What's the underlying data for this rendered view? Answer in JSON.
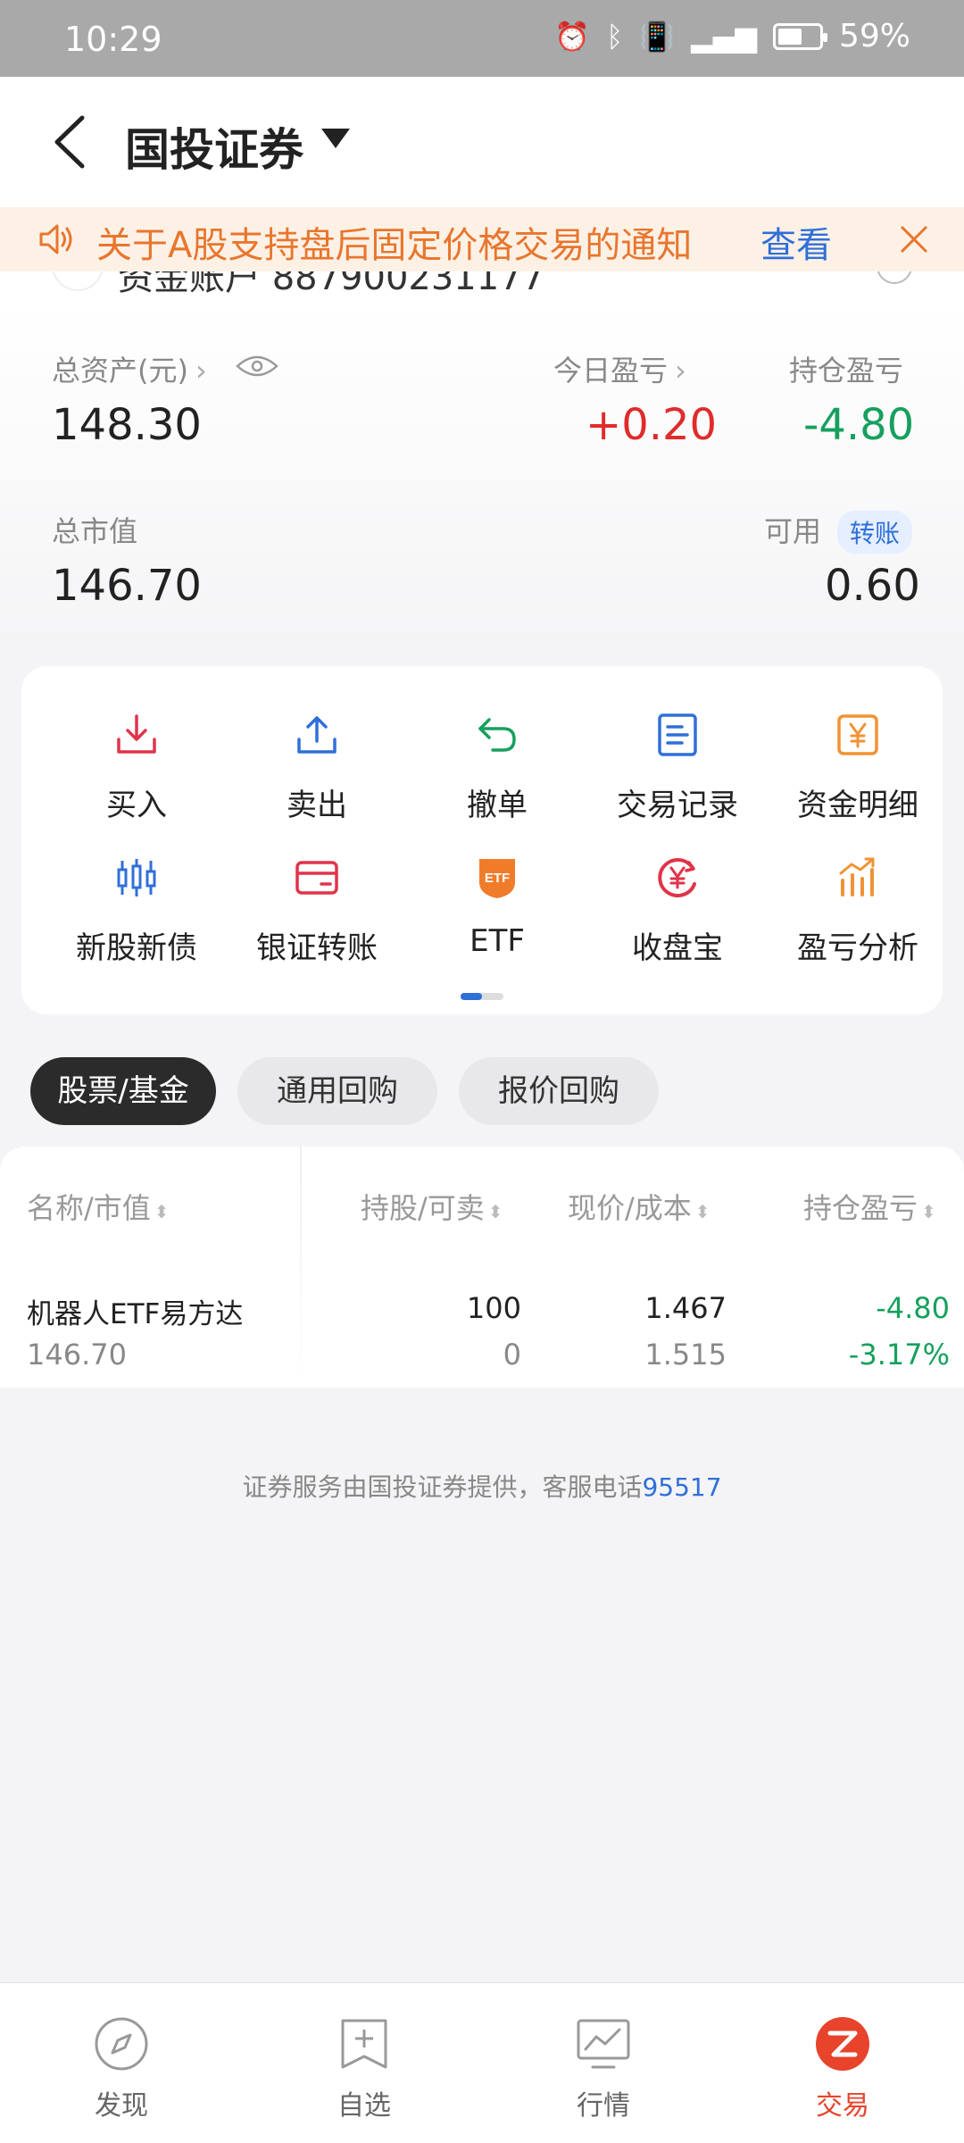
{
  "status_bar": {
    "time": "10:29",
    "battery": "59%",
    "battery_level": 0.59
  },
  "header": {
    "title": "国投证券"
  },
  "notice": {
    "text": "关于A股支持盘后固定价格交易的通知",
    "action": "查看"
  },
  "account": {
    "label": "资金账户 887900231177"
  },
  "summary": {
    "total_assets_label": "总资产(元)",
    "total_assets": "148.30",
    "today_pl_label": "今日盈亏",
    "today_pl": "+0.20",
    "position_pl_label": "持仓盈亏",
    "position_pl": "-4.80",
    "market_value_label": "总市值",
    "market_value": "146.70",
    "available_label": "可用",
    "transfer_label": "转账",
    "available": "0.60"
  },
  "functions": [
    {
      "label": "买入",
      "icon": "buy-icon",
      "color": "#e0344a"
    },
    {
      "label": "卖出",
      "icon": "sell-icon",
      "color": "#2f6fd8"
    },
    {
      "label": "撤单",
      "icon": "undo-icon",
      "color": "#16a05d"
    },
    {
      "label": "交易记录",
      "icon": "record-icon",
      "color": "#2f6fd8"
    },
    {
      "label": "资金明细",
      "icon": "yen-icon",
      "color": "#f09234"
    },
    {
      "label": "新股新债",
      "icon": "candlestick-icon",
      "color": "#2f6fd8"
    },
    {
      "label": "银证转账",
      "icon": "card-icon",
      "color": "#e0344a"
    },
    {
      "label": "ETF",
      "icon": "etf-icon",
      "color": "#f07c2a"
    },
    {
      "label": "收盘宝",
      "icon": "yen-circle-icon",
      "color": "#e0344a"
    },
    {
      "label": "盈亏分析",
      "icon": "bar-chart-icon",
      "color": "#f09234"
    }
  ],
  "tabs": [
    {
      "label": "股票/基金",
      "active": true
    },
    {
      "label": "通用回购",
      "active": false
    },
    {
      "label": "报价回购",
      "active": false
    }
  ],
  "table": {
    "headers": [
      "名称/市值",
      "持股/可卖",
      "现价/成本",
      "持仓盈亏"
    ],
    "rows": [
      {
        "name": "机器人ETF易方达",
        "market_value": "146.70",
        "shares": "100",
        "sellable": "0",
        "price": "1.467",
        "cost": "1.515",
        "pl": "-4.80",
        "pl_pct": "-3.17%"
      }
    ]
  },
  "footer": {
    "note": "证券服务由国投证券提供，客服电话",
    "phone": "95517"
  },
  "bottom_nav": [
    {
      "label": "发现",
      "icon": "compass-icon",
      "active": false
    },
    {
      "label": "自选",
      "icon": "add-favorite-icon",
      "active": false
    },
    {
      "label": "行情",
      "icon": "market-chart-icon",
      "active": false
    },
    {
      "label": "交易",
      "icon": "trade-icon",
      "active": true
    }
  ],
  "colors": {
    "up": "#e02b2b",
    "down": "#16a05d",
    "accent": "#2f6fd8",
    "brand": "#e8432b"
  }
}
